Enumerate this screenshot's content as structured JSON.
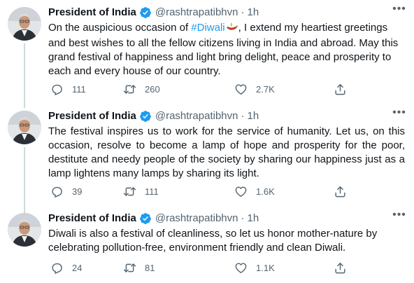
{
  "tweets": [
    {
      "name": "President of India",
      "handle": "@rashtrapatibhvn",
      "separator": "·",
      "time": "1h",
      "text_before": "On the auspicious occasion of ",
      "hashtag": "#Diwali",
      "text_after": ", I extend my heartiest greetings and best wishes to all the fellow citizens living in India and abroad. May this grand festival of happiness and light bring delight, peace and prosperity to each and every house of our country.",
      "replies": "111",
      "retweets": "260",
      "likes": "2.7K"
    },
    {
      "name": "President of India",
      "handle": "@rashtrapatibhvn",
      "separator": "·",
      "time": "1h",
      "text": "The festival inspires us to work for the service of humanity. Let us, on this occasion, resolve to become a lamp of hope and prosperity for the poor, destitute and needy people of the society by sharing our happiness just as a lamp lightens many lamps by sharing its light.",
      "replies": "39",
      "retweets": "111",
      "likes": "1.6K"
    },
    {
      "name": "President of India",
      "handle": "@rashtrapatibhvn",
      "separator": "·",
      "time": "1h",
      "text": "Diwali is also a festival of cleanliness, so let us honor mother-nature by celebrating pollution-free, environment friendly and clean Diwali.",
      "replies": "24",
      "retweets": "81",
      "likes": "1.1K"
    }
  ],
  "icons": {
    "verified": "verified-badge-icon",
    "more": "more-options-icon",
    "reply": "reply-icon",
    "retweet": "retweet-icon",
    "like": "like-icon",
    "share": "share-icon",
    "diwali_lamp": "diwali-lamp-emoji"
  },
  "colors": {
    "verified": "#1d9bf0",
    "hashtag": "#1d9bf0",
    "text": "#0f1419",
    "muted": "#536471",
    "thread_line": "#cfd9de"
  }
}
